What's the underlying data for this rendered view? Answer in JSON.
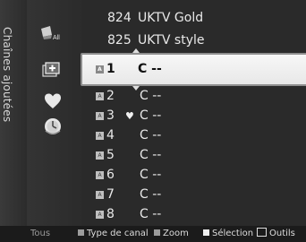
{
  "sidebar": {
    "title": "Chaînes ajoutées"
  },
  "icons": {
    "all_label": "All",
    "all": "all-channels-icon",
    "added": "added-channels-icon",
    "favorite": "favorite-icon",
    "scheduled": "scheduled-icon"
  },
  "channels": [
    {
      "num": "824",
      "name": "UKTV Gold"
    },
    {
      "num": "825",
      "name": "UKTV style"
    },
    {
      "num": "1",
      "name": "C --",
      "selected": true
    },
    {
      "num": "2",
      "name": "C --"
    },
    {
      "num": "3",
      "name": "C --",
      "favorite": true
    },
    {
      "num": "4",
      "name": "C --"
    },
    {
      "num": "5",
      "name": "C --"
    },
    {
      "num": "6",
      "name": "C --"
    },
    {
      "num": "7",
      "name": "C --"
    },
    {
      "num": "8",
      "name": "C --"
    }
  ],
  "badge_letter": "A",
  "heart_glyph": "♥",
  "footer": {
    "left": "Tous",
    "type": "Type de canal",
    "zoom": "Zoom",
    "select": "Sélection",
    "tools": "Outils"
  }
}
